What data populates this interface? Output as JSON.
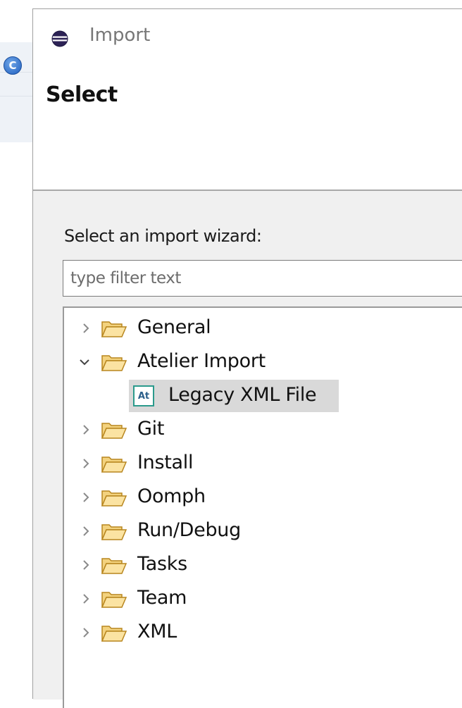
{
  "background": {
    "app_icon_letter": "C"
  },
  "dialog": {
    "title": "Import",
    "header_title": "Select",
    "prompt": "Select an import wizard:",
    "filter_placeholder": "type filter text",
    "colors": {
      "folder": "#e8b94a",
      "selection": "#d9d9d9",
      "body": "#f0f0f0"
    }
  },
  "tree": {
    "items": [
      {
        "label": "General",
        "expanded": false
      },
      {
        "label": "Atelier Import",
        "expanded": true
      },
      {
        "label": "Legacy XML File",
        "child": true,
        "selected": true,
        "icon": "atelier-icon",
        "icon_text": "At"
      },
      {
        "label": "Git",
        "expanded": false
      },
      {
        "label": "Install",
        "expanded": false
      },
      {
        "label": "Oomph",
        "expanded": false
      },
      {
        "label": "Run/Debug",
        "expanded": false
      },
      {
        "label": "Tasks",
        "expanded": false
      },
      {
        "label": "Team",
        "expanded": false
      },
      {
        "label": "XML",
        "expanded": false
      }
    ]
  }
}
